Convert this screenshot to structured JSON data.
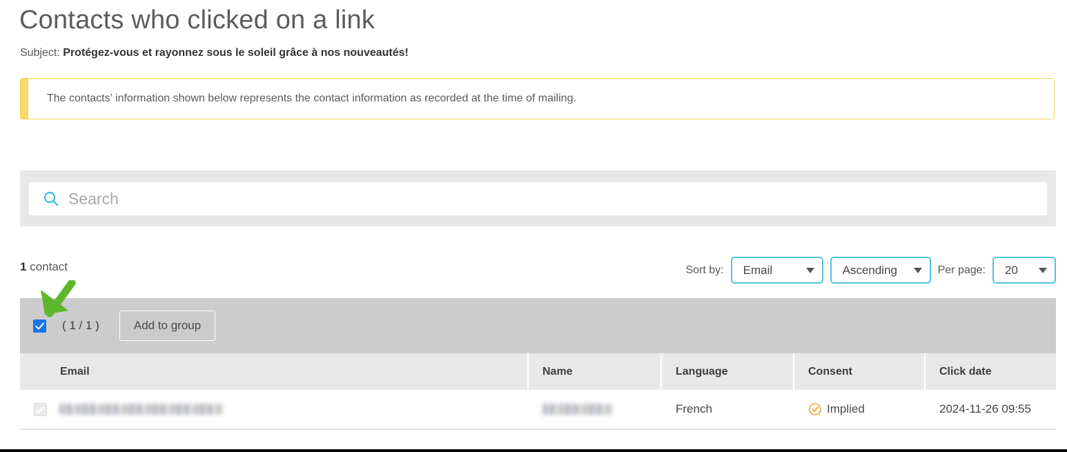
{
  "page": {
    "title": "Contacts who clicked on a link",
    "subject_label": "Subject:",
    "subject_value": "Protégez-vous et rayonnez sous le soleil grâce à nos nouveautés!"
  },
  "notice": {
    "text": "The contacts’ information shown below represents the contact information as recorded at the time of mailing.",
    "accent_color": "#fadb6a",
    "border_color": "#f5d157"
  },
  "search": {
    "value": "",
    "placeholder": "Search",
    "icon": "search-icon",
    "icon_color": "#29b6e8"
  },
  "summary": {
    "count": "1",
    "count_label": "contact"
  },
  "controls": {
    "sort_by_label": "Sort by:",
    "sort_field": "Email",
    "sort_order": "Ascending",
    "per_page_label": "Per page:",
    "per_page": "20",
    "select_border_color": "#4ec3e0"
  },
  "toolbar": {
    "select_all_checked": true,
    "selection_count": "( 1 / 1 )",
    "add_to_group_label": "Add to group",
    "background": "#cccccc",
    "checkbox_color": "#1a73e8"
  },
  "table": {
    "columns": [
      "Email",
      "Name",
      "Language",
      "Consent",
      "Click date"
    ],
    "rows": [
      {
        "checked": true,
        "email": "",
        "name": "",
        "language": "French",
        "consent": "Implied",
        "consent_icon": "check-circle-icon",
        "consent_color": "#f0a22e",
        "click_date": "2024-11-26 09:55"
      }
    ],
    "header_background": "#e8e8e8"
  },
  "annotation": {
    "arrow_icon": "green-arrow-icon",
    "arrow_color": "#5cb82a",
    "points_at": "select-all-checkbox"
  }
}
